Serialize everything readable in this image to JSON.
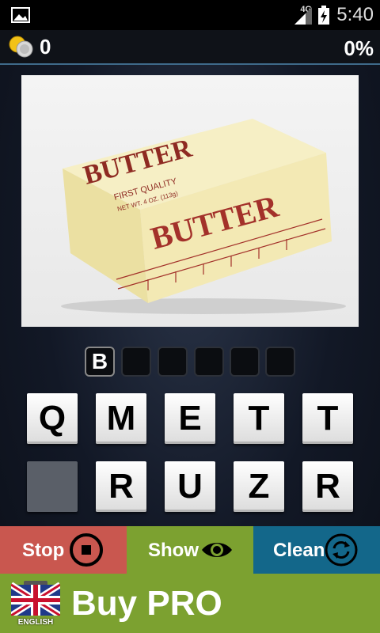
{
  "status_bar": {
    "time": "5:40",
    "network": "4G"
  },
  "header": {
    "coins": "0",
    "progress": "0%"
  },
  "puzzle": {
    "image_label_main": "BUTTER",
    "image_label_small": "BUTTER",
    "image_subtitle": "FIRST QUALITY",
    "image_weight": "NET WT. 4 OZ. (113g)",
    "answer_slots": [
      "B",
      "",
      "",
      "",
      "",
      ""
    ]
  },
  "keys": [
    "Q",
    "M",
    "E",
    "T",
    "T",
    "",
    "R",
    "U",
    "Z",
    "R"
  ],
  "actions": {
    "stop": "Stop",
    "show": "Show",
    "clean": "Clean"
  },
  "buy": {
    "label": "Buy PRO",
    "language": "ENGLISH"
  },
  "colors": {
    "stop": "#c9574f",
    "show": "#7ca130",
    "clean": "#13678a",
    "accent": "#3f6a8a"
  }
}
